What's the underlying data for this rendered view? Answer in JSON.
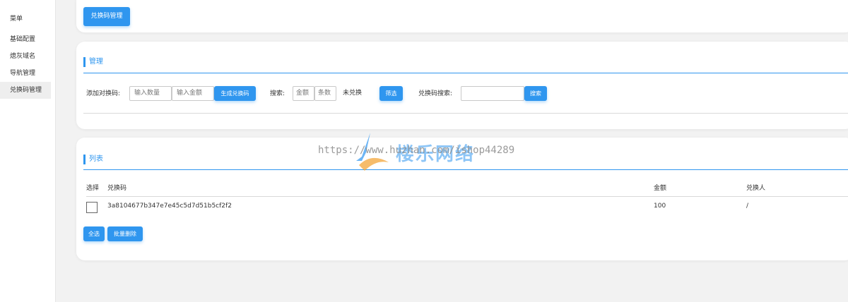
{
  "sidebar": {
    "title": "菜单",
    "items": [
      {
        "label": "基础配置"
      },
      {
        "label": "熄灰域名"
      },
      {
        "label": "导航管理"
      },
      {
        "label": "兑换码管理"
      }
    ]
  },
  "header_card": {
    "button_label": "兑换码管理"
  },
  "manage": {
    "title": "管理",
    "add_label": "添加对换码:",
    "qty_placeholder": "输入数量",
    "amount_placeholder": "输入金额",
    "generate_label": "生成兑换码",
    "search_label": "搜索:",
    "amount_filter": "金额",
    "count_filter": "条数",
    "status_value": "未兑换",
    "filter_button": "筛选",
    "code_search_label": "兑换码搜索:",
    "code_search_value": "",
    "search_button": "搜索"
  },
  "list": {
    "title": "列表",
    "columns": [
      "选择",
      "兑换码",
      "金额",
      "兑换人"
    ],
    "rows": [
      {
        "code": "3a8104677b347e7e45c5d7d51b5cf2f2",
        "amount": "100",
        "redeemer": "/"
      }
    ],
    "select_all": "全选",
    "batch_delete": "批量删除"
  },
  "watermark": {
    "url": "https://www.huzhan.com/ishop44289",
    "brand": "楼乐网络",
    "colors": {
      "blue": "#2f96ef",
      "orange": "#f3a53a"
    }
  },
  "colors": {
    "accent": "#2f96ef",
    "background": "#f2f2f2"
  }
}
